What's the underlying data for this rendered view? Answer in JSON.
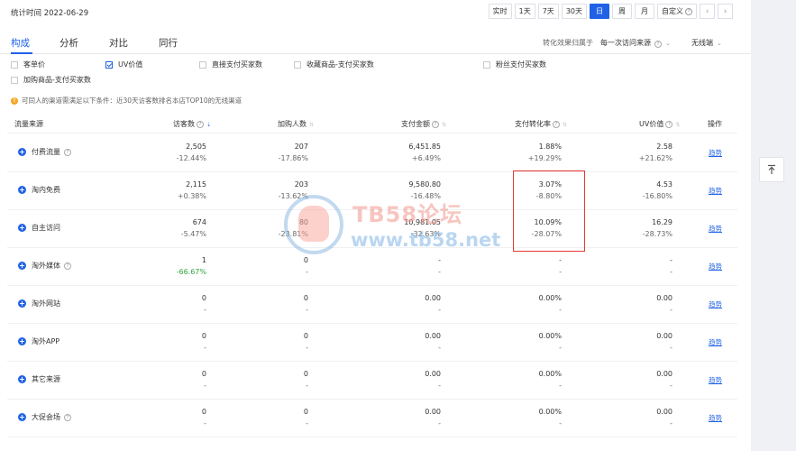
{
  "header": {
    "stat_time": "统计时间 2022-06-29",
    "ranges": [
      "实时",
      "1天",
      "7天",
      "30天",
      "日",
      "周",
      "月",
      "自定义"
    ],
    "active_range": "日"
  },
  "tabs": [
    "构成",
    "分析",
    "对比",
    "同行"
  ],
  "filters": {
    "conversion_label": "转化效果归属于",
    "conversion_value": "每一次访问来源",
    "terminal_value": "无线端"
  },
  "metrics": [
    {
      "label": "客单价",
      "checked": false
    },
    {
      "label": "UV价值",
      "checked": true
    },
    {
      "label": "直接支付买家数",
      "checked": false
    },
    {
      "label": "收藏商品-支付买家数",
      "checked": false
    },
    {
      "label": "粉丝支付买家数",
      "checked": false
    },
    {
      "label": "加购商品-支付买家数",
      "checked": false
    }
  ],
  "notice": "可同人的渠道需满足以下条件：近30天访客数排名本店TOP10的无线渠道",
  "table": {
    "headers": [
      "流量来源",
      "访客数",
      "加购人数",
      "支付金额",
      "支付转化率",
      "UV价值",
      "操作"
    ],
    "action_label": "趋势",
    "rows": [
      {
        "source": "付费流量",
        "help": true,
        "visitors": [
          "2,505",
          "-12.44%"
        ],
        "cart": [
          "207",
          "-17.86%"
        ],
        "pay": [
          "6,451.85",
          "+6.49%"
        ],
        "conv": [
          "1.88%",
          "+19.29%"
        ],
        "uv": [
          "2.58",
          "+21.62%"
        ]
      },
      {
        "source": "淘内免费",
        "help": false,
        "visitors": [
          "2,115",
          "+0.38%"
        ],
        "cart": [
          "203",
          "-13.62%"
        ],
        "pay": [
          "9,580.80",
          "-16.48%"
        ],
        "conv": [
          "3.07%",
          "-8.80%"
        ],
        "uv": [
          "4.53",
          "-16.80%"
        ]
      },
      {
        "source": "自主访问",
        "help": false,
        "visitors": [
          "674",
          "-5.47%"
        ],
        "cart": [
          "80",
          "-23.81%"
        ],
        "pay": [
          "10,981.05",
          "-32.63%"
        ],
        "conv": [
          "10.09%",
          "-28.07%"
        ],
        "uv": [
          "16.29",
          "-28.73%"
        ]
      },
      {
        "source": "淘外媒体",
        "help": true,
        "visitors": [
          "1",
          "-66.67%"
        ],
        "cart": [
          "0",
          "-"
        ],
        "pay": [
          "-",
          "-"
        ],
        "conv": [
          "-",
          "-"
        ],
        "uv": [
          "-",
          "-"
        ]
      },
      {
        "source": "淘外网站",
        "help": false,
        "visitors": [
          "0",
          "-"
        ],
        "cart": [
          "0",
          "-"
        ],
        "pay": [
          "0.00",
          "-"
        ],
        "conv": [
          "0.00%",
          "-"
        ],
        "uv": [
          "0.00",
          "-"
        ]
      },
      {
        "source": "淘外APP",
        "help": false,
        "visitors": [
          "0",
          "-"
        ],
        "cart": [
          "0",
          "-"
        ],
        "pay": [
          "0.00",
          "-"
        ],
        "conv": [
          "0.00%",
          "-"
        ],
        "uv": [
          "0.00",
          "-"
        ]
      },
      {
        "source": "其它来源",
        "help": false,
        "visitors": [
          "0",
          "-"
        ],
        "cart": [
          "0",
          "-"
        ],
        "pay": [
          "0.00",
          "-"
        ],
        "conv": [
          "0.00%",
          "-"
        ],
        "uv": [
          "0.00",
          "-"
        ]
      },
      {
        "source": "大促会场",
        "help": true,
        "visitors": [
          "0",
          "-"
        ],
        "cart": [
          "0",
          "-"
        ],
        "pay": [
          "0.00",
          "-"
        ],
        "conv": [
          "0.00%",
          "-"
        ],
        "uv": [
          "0.00",
          "-"
        ]
      }
    ]
  },
  "watermark": {
    "line1": "TB58论坛",
    "line2": "www.tb58.net"
  },
  "colors": {
    "accent": "#2062e6",
    "up": "#2aa73e",
    "highlight": "#e53935"
  }
}
